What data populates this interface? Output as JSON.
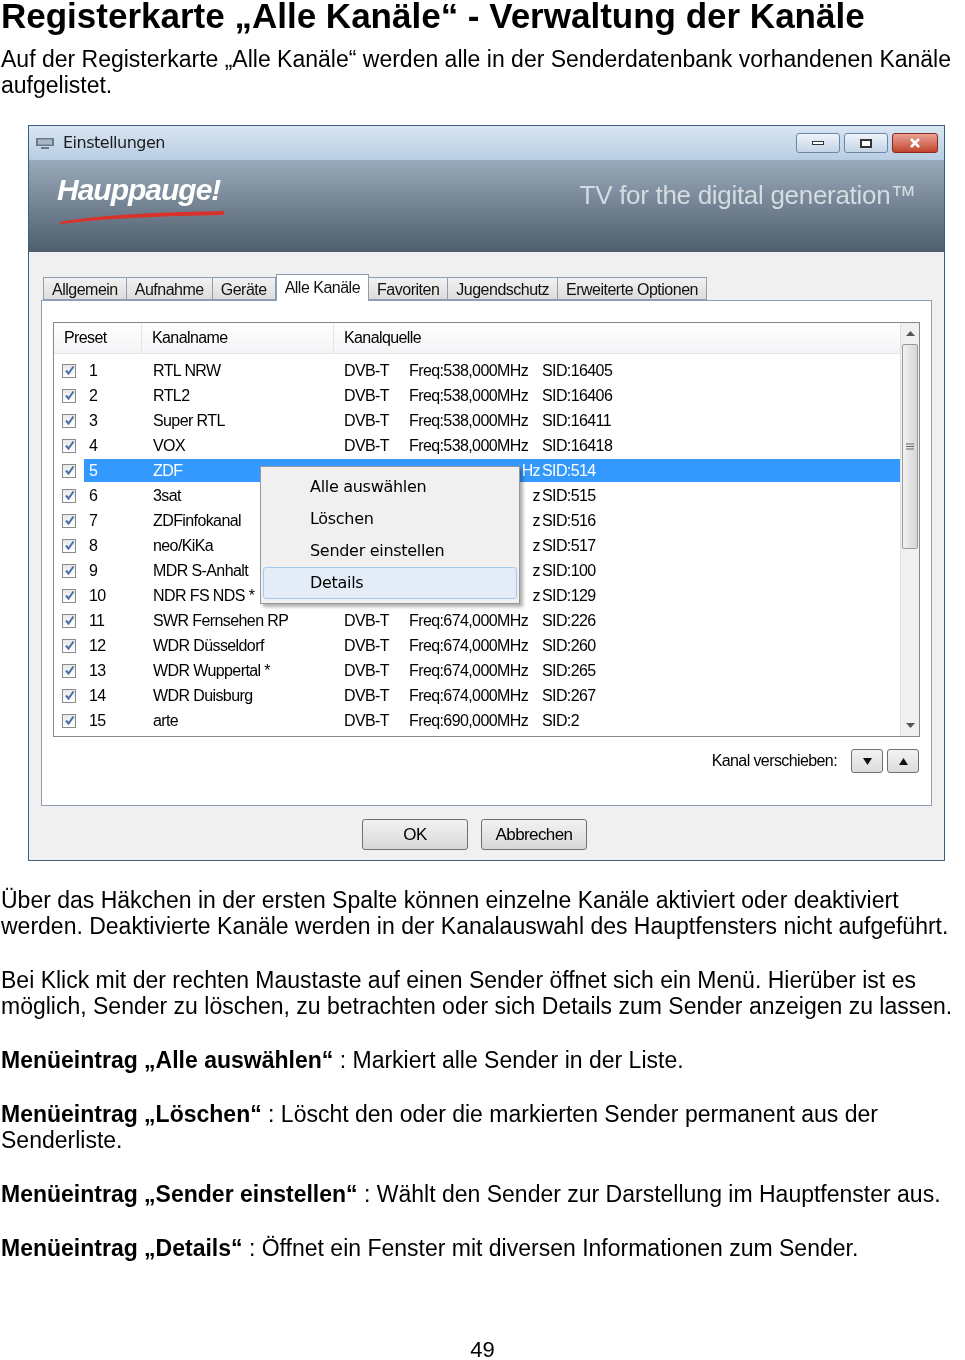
{
  "heading": "Registerkarte „Alle Kanäle“ - Verwaltung der Kanäle",
  "intro": "Auf der Registerkarte „Alle Kanäle“ werden alle in der Senderdatenbank vorhandenen Kanäle aufgelistet.",
  "window": {
    "title": "Einstellungen",
    "logo": "Hauppauge!",
    "slogan": "TV for the digital generation™",
    "tabs": [
      {
        "label": "Allgemein",
        "selected": false
      },
      {
        "label": "Aufnahme",
        "selected": false
      },
      {
        "label": "Geräte",
        "selected": false
      },
      {
        "label": "Alle Kanäle",
        "selected": true
      },
      {
        "label": "Favoriten",
        "selected": false
      },
      {
        "label": "Jugendschutz",
        "selected": false
      },
      {
        "label": "Erweiterte Optionen",
        "selected": false
      }
    ],
    "table": {
      "columns": [
        "Preset",
        "Kanalname",
        "Kanalquelle"
      ],
      "rows": [
        {
          "checked": true,
          "preset": "1",
          "name": "RTL NRW",
          "source": "DVB-T",
          "freq": "Freq:538,000MHz",
          "sid": "SID:16405",
          "selected": false
        },
        {
          "checked": true,
          "preset": "2",
          "name": "RTL2",
          "source": "DVB-T",
          "freq": "Freq:538,000MHz",
          "sid": "SID:16406",
          "selected": false
        },
        {
          "checked": true,
          "preset": "3",
          "name": "Super RTL",
          "source": "DVB-T",
          "freq": "Freq:538,000MHz",
          "sid": "SID:16411",
          "selected": false
        },
        {
          "checked": true,
          "preset": "4",
          "name": "VOX",
          "source": "DVB-T",
          "freq": "Freq:538,000MHz",
          "sid": "SID:16418",
          "selected": false
        },
        {
          "checked": true,
          "preset": "5",
          "name": "ZDF",
          "freq": "Hz",
          "sid": "SID:514",
          "selected": true
        },
        {
          "checked": true,
          "preset": "6",
          "name": "3sat",
          "freq": "z",
          "sid": "SID:515",
          "selected": false
        },
        {
          "checked": true,
          "preset": "7",
          "name": "ZDFinfokanal",
          "freq": "z",
          "sid": "SID:516",
          "selected": false
        },
        {
          "checked": true,
          "preset": "8",
          "name": "neo/KiKa",
          "freq": "z",
          "sid": "SID:517",
          "selected": false
        },
        {
          "checked": true,
          "preset": "9",
          "name": "MDR S-Anhalt",
          "freq": "z",
          "sid": "SID:100",
          "selected": false
        },
        {
          "checked": true,
          "preset": "10",
          "name": "NDR FS NDS *",
          "freq": "z",
          "sid": "SID:129",
          "selected": false
        },
        {
          "checked": true,
          "preset": "11",
          "name": "SWR Fernsehen RP",
          "source": "DVB-T",
          "freq": "Freq:674,000MHz",
          "sid": "SID:226",
          "selected": false
        },
        {
          "checked": true,
          "preset": "12",
          "name": "WDR Düsseldorf",
          "source": "DVB-T",
          "freq": "Freq:674,000MHz",
          "sid": "SID:260",
          "selected": false
        },
        {
          "checked": true,
          "preset": "13",
          "name": "WDR Wuppertal *",
          "source": "DVB-T",
          "freq": "Freq:674,000MHz",
          "sid": "SID:265",
          "selected": false
        },
        {
          "checked": true,
          "preset": "14",
          "name": "WDR Duisburg",
          "source": "DVB-T",
          "freq": "Freq:674,000MHz",
          "sid": "SID:267",
          "selected": false
        },
        {
          "checked": true,
          "preset": "15",
          "name": "arte",
          "source": "DVB-T",
          "freq": "Freq:690,000MHz",
          "sid": "SID:2",
          "selected": false
        }
      ]
    },
    "context_menu": [
      {
        "label": "Alle auswählen",
        "selected": false
      },
      {
        "label": "Löschen",
        "selected": false
      },
      {
        "label": "Sender einstellen",
        "selected": false
      },
      {
        "label": "Details",
        "selected": true
      }
    ],
    "move_label": "Kanal verschieben:",
    "buttons": [
      "OK",
      "Abbrechen"
    ]
  },
  "paragraphs": [
    "Über das Häkchen in der ersten Spalte können einzelne Kanäle aktiviert oder deaktiviert werden. Deaktivierte Kanäle werden in der Kanalauswahl des Hauptfensters nicht aufgeführt.",
    "Bei Klick mit der rechten Maustaste auf einen Sender öffnet sich ein Menü. Hierüber ist es möglich, Sender zu löschen, zu betrachten oder sich Details zum Sender anzeigen zu lassen.",
    "**Menüeintrag „Alle auswählen“** : Markiert alle Sender in der Liste.",
    "**Menüeintrag „Löschen“** : Löscht den oder die markierten Sender permanent aus der Senderliste.",
    "**Menüeintrag „Sender einstellen“** : Wählt den Sender zur Darstellung im Hauptfenster aus.",
    "**Menüeintrag „Details“** : Öffnet ein Fenster mit diversen Informationen zum Sender."
  ],
  "page_number": "49"
}
